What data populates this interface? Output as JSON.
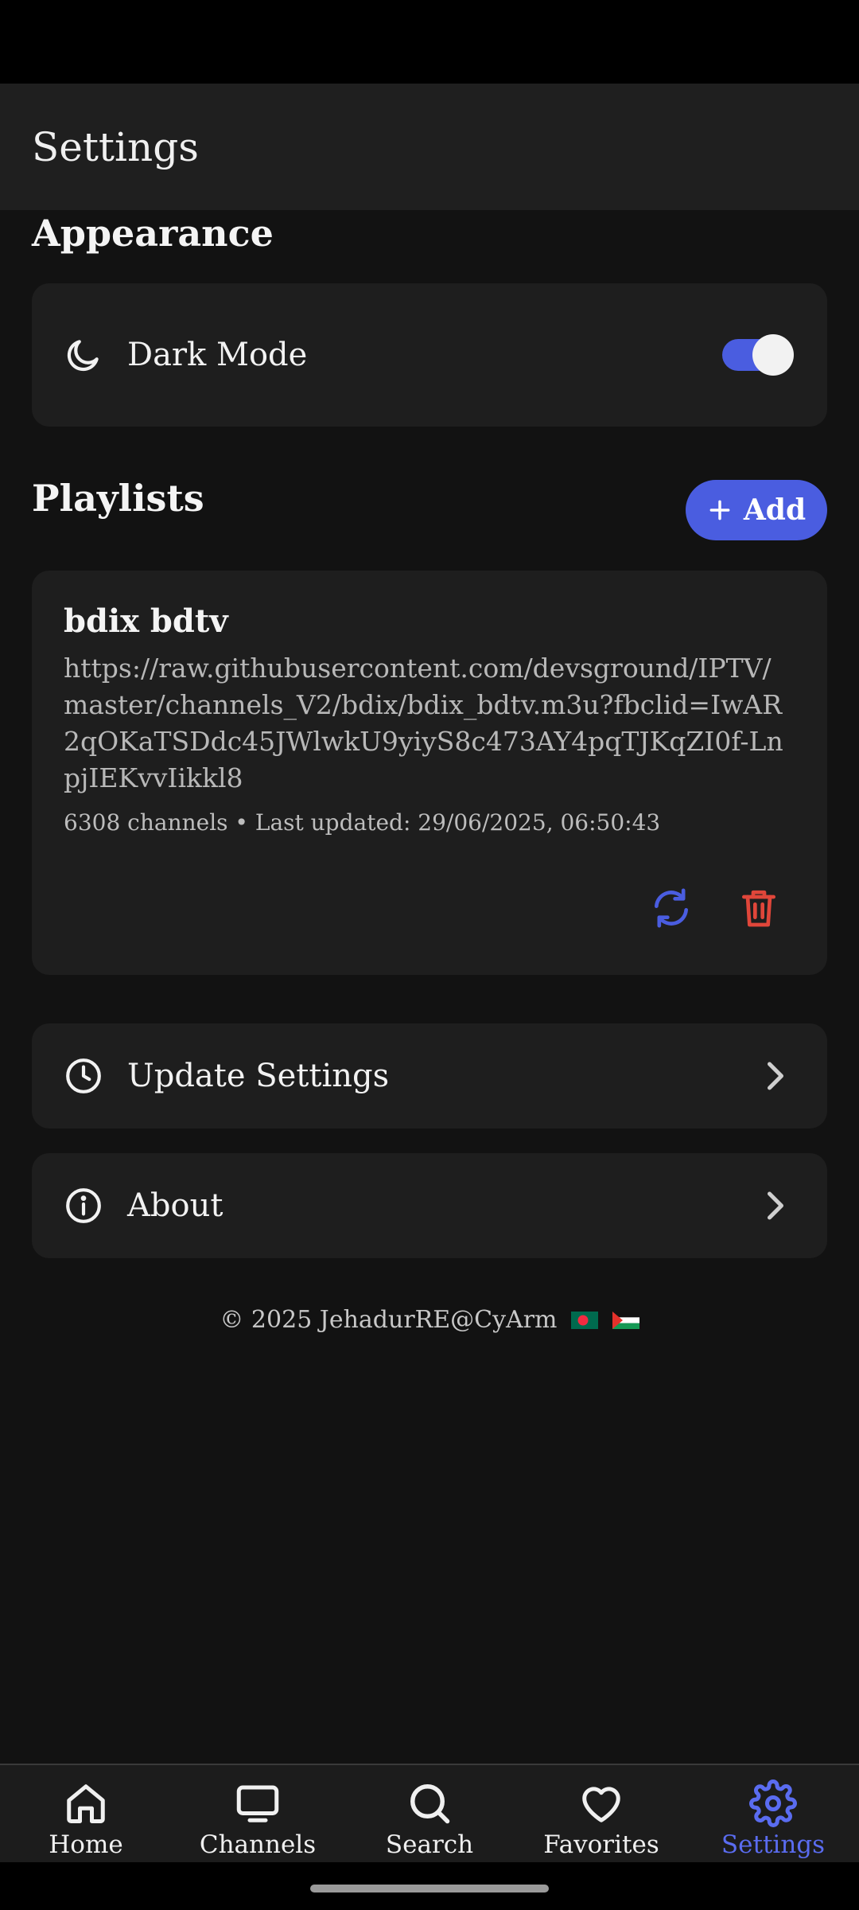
{
  "app_bar": {
    "title": "Settings"
  },
  "appearance": {
    "section_title": "Appearance",
    "dark_mode": {
      "label": "Dark Mode",
      "enabled": true,
      "icon": "moon-icon"
    }
  },
  "playlists": {
    "section_title": "Playlists",
    "add_label": "Add",
    "items": [
      {
        "name": "bdix bdtv",
        "url": "https://raw.githubusercontent.com/devsground/IPTV/master/channels_V2/bdix/bdix_bdtv.m3u?fbclid=IwAR2qOKaTSDdc45JWlwkU9yiyS8c473AY4pqTJKqZI0f-LnpjIEKvvIikkl8",
        "meta": "6308 channels • Last updated: 29/06/2025, 06:50:43"
      }
    ]
  },
  "menu": [
    {
      "label": "Update Settings",
      "icon": "clock-icon"
    },
    {
      "label": "About",
      "icon": "info-icon"
    }
  ],
  "footer": {
    "text": "© 2025 JehadurRE@CyArm",
    "flags": [
      "bangladesh-flag",
      "palestine-flag"
    ]
  },
  "bottom_nav": {
    "items": [
      {
        "label": "Home",
        "icon": "home-icon"
      },
      {
        "label": "Channels",
        "icon": "tv-icon"
      },
      {
        "label": "Search",
        "icon": "search-icon"
      },
      {
        "label": "Favorites",
        "icon": "heart-icon"
      },
      {
        "label": "Settings",
        "icon": "gear-icon",
        "active": true
      }
    ]
  },
  "colors": {
    "accent": "#4a5de0",
    "danger": "#e0463a",
    "background": "#121212",
    "card": "#1e1e1e"
  }
}
